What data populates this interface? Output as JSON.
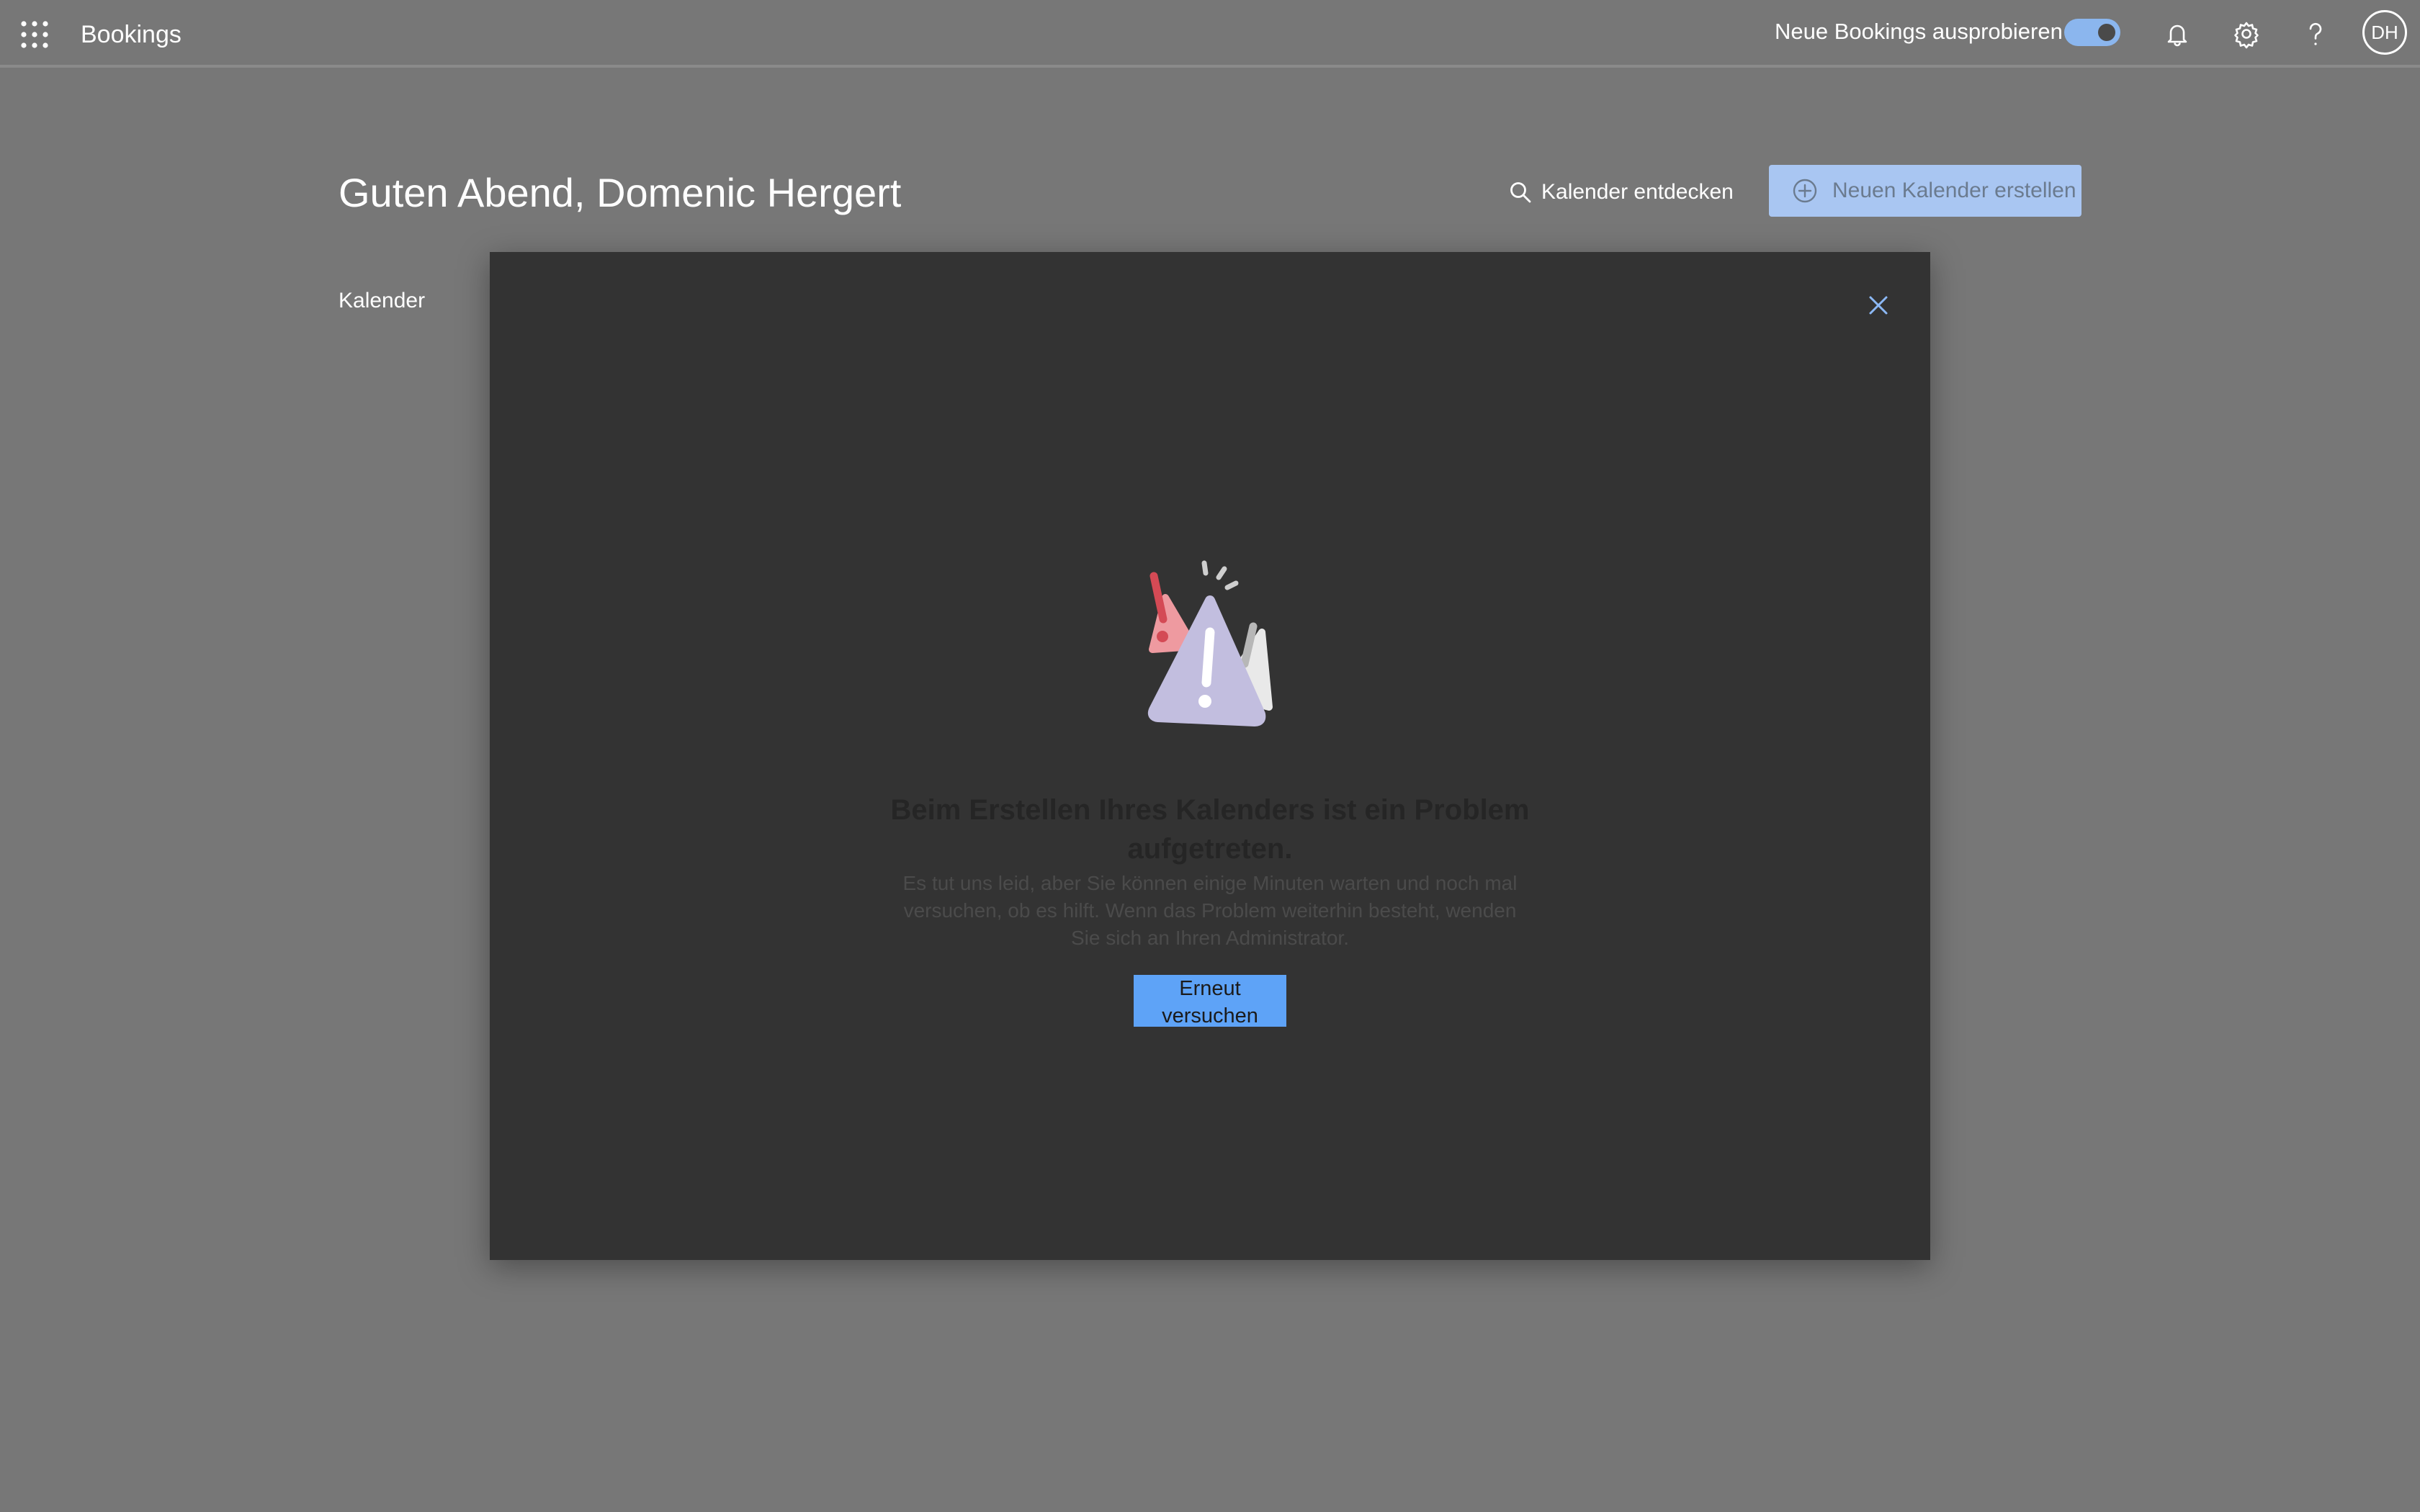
{
  "header": {
    "app_title": "Bookings",
    "try_new_label": "Neue Bookings ausprobieren",
    "try_new_enabled": true,
    "avatar_initials": "DH",
    "icons": [
      "waffle-icon",
      "bell-icon",
      "gear-icon",
      "help-icon"
    ]
  },
  "main": {
    "greeting": "Guten Abend, Domenic Hergert",
    "discover_label": "Kalender entdecken",
    "new_calendar_label": "Neuen Kalender erstellen",
    "section_label": "Kalender"
  },
  "dialog": {
    "title": "Beim Erstellen Ihres Kalenders ist ein Problem aufgetreten.",
    "description": "Es tut uns leid, aber Sie können einige Minuten warten und noch mal versuchen, ob es hilft. Wenn das Problem weiterhin besteht, wenden Sie sich an Ihren Administrator.",
    "retry_label": "Erneut versuchen"
  },
  "colors": {
    "overlay": "#777777",
    "dialog_bg": "#333333",
    "accent": "#5ea3f7",
    "primary_disabled": "#a9c6f2"
  }
}
